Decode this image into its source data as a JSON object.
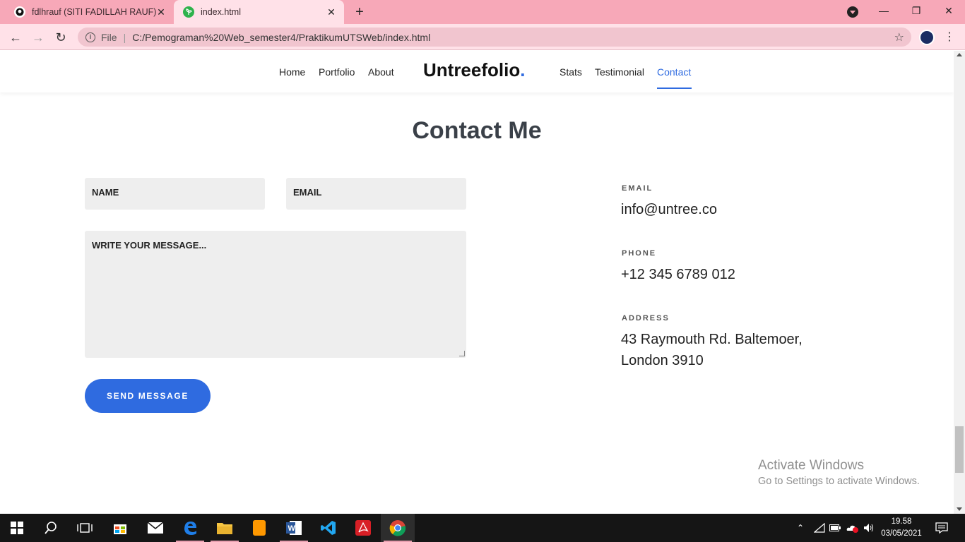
{
  "browser": {
    "tabs": [
      {
        "title": "fdlhrauf (SITI FADILLAH RAUF)",
        "icon": "github-icon",
        "active": false
      },
      {
        "title": "index.html",
        "icon": "leaf-icon",
        "active": true
      }
    ],
    "address": {
      "scheme_label": "File",
      "url": "C:/Pemograman%20Web_semester4/PraktikumUTSWeb/index.html"
    }
  },
  "site": {
    "nav_left": [
      "Home",
      "Portfolio",
      "About"
    ],
    "logo_text": "Untreefolio",
    "logo_dot": ".",
    "nav_right": [
      "Stats",
      "Testimonial",
      "Contact"
    ],
    "active_link": "Contact",
    "accent_color": "#2f6be0"
  },
  "contact": {
    "title": "Contact Me",
    "form": {
      "name_placeholder": "NAME",
      "email_placeholder": "EMAIL",
      "message_placeholder": "WRITE YOUR MESSAGE...",
      "submit_label": "SEND MESSAGE"
    },
    "info": {
      "email_label": "EMAIL",
      "email_value": "info@untree.co",
      "phone_label": "PHONE",
      "phone_value": "+12 345 6789 012",
      "address_label": "ADDRESS",
      "address_line1": "43 Raymouth Rd. Baltemoer,",
      "address_line2": "London 3910"
    }
  },
  "watermark": {
    "line1": "Activate Windows",
    "line2": "Go to Settings to activate Windows."
  },
  "taskbar": {
    "apps": [
      "start-icon",
      "search-icon",
      "task-view-icon",
      "store-icon",
      "mail-icon",
      "edge-icon",
      "file-explorer-icon",
      "sublime-text-icon",
      "word-icon",
      "vscode-icon",
      "acrobat-icon",
      "chrome-icon"
    ],
    "clock_time": "19.58",
    "clock_date": "03/05/2021"
  }
}
